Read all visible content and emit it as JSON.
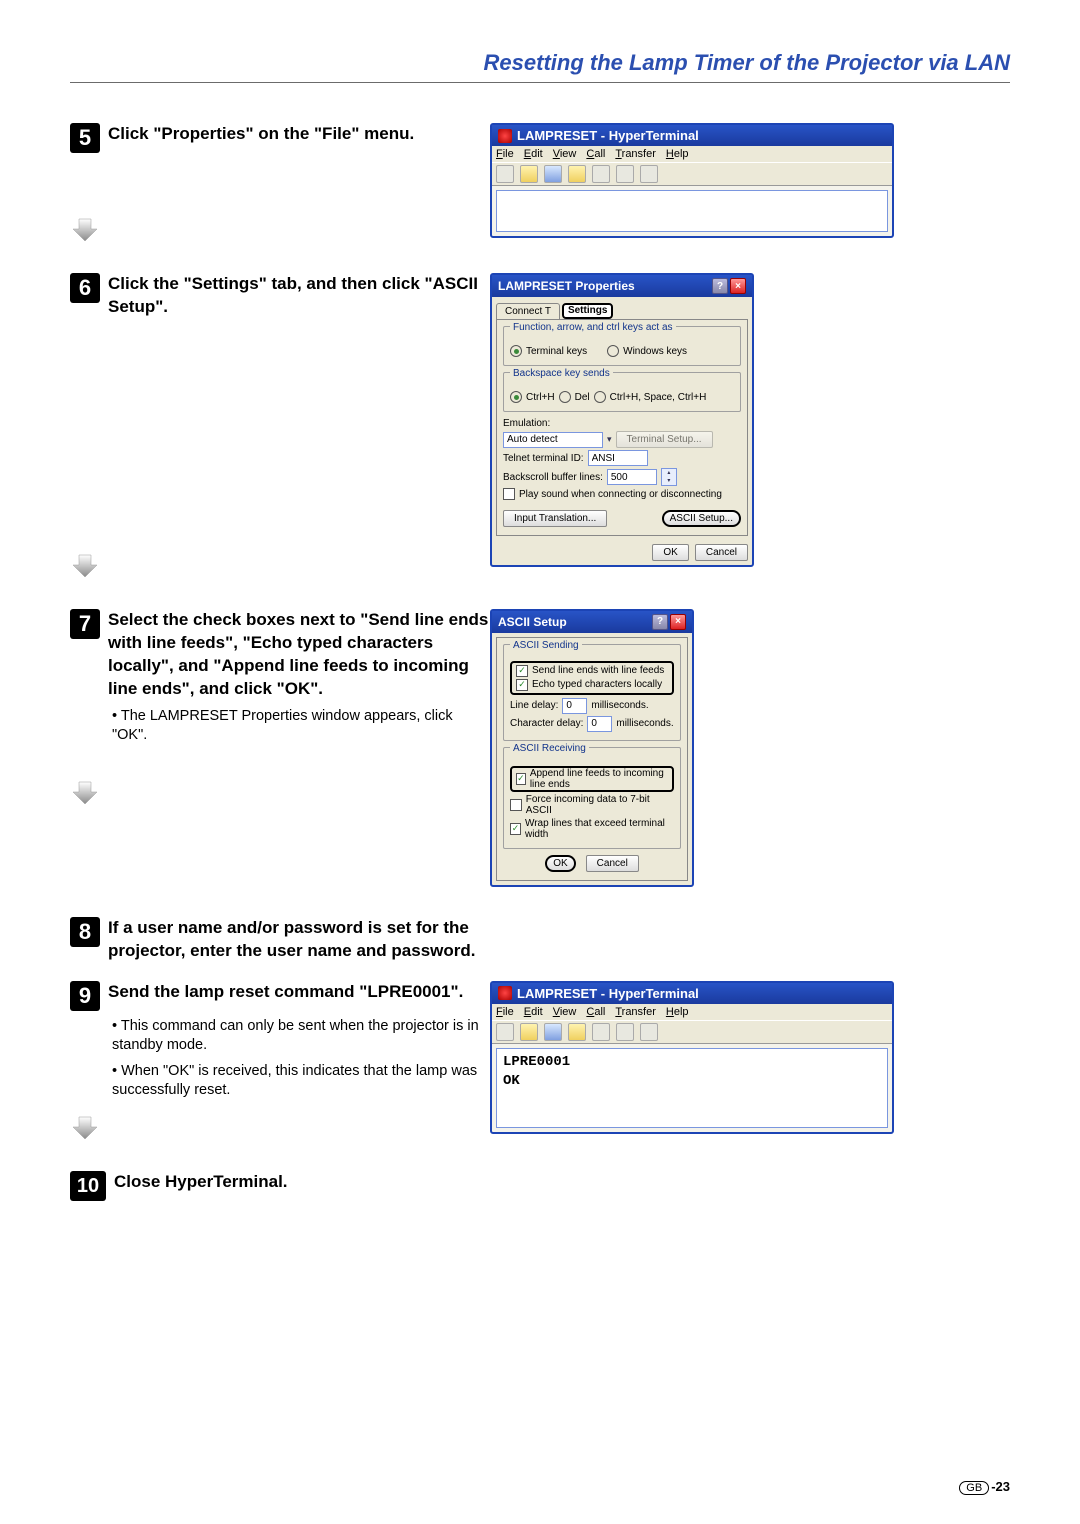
{
  "heading": "Resetting the Lamp Timer of the Projector via LAN",
  "steps": {
    "5": {
      "n": "5",
      "text": "Click \"Properties\" on the \"File\" menu."
    },
    "6": {
      "n": "6",
      "text": "Click the \"Settings\" tab, and then click \"ASCII Setup\"."
    },
    "7": {
      "n": "7",
      "text": "Select the check boxes next to \"Send line ends with line feeds\", \"Echo typed characters locally\", and \"Append line feeds to incoming line ends\", and click \"OK\".",
      "sub": "• The LAMPRESET Properties window appears, click \"OK\"."
    },
    "8": {
      "n": "8",
      "text": "If a user name and/or password is set for the projector, enter the user name and password."
    },
    "9": {
      "n": "9",
      "text": "Send the lamp reset command \"LPRE0001\".",
      "sub1": "• This command can only be sent when the projector is in standby mode.",
      "sub2": "• When \"OK\" is received, this indicates that the lamp was successfully reset."
    },
    "10": {
      "n": "10",
      "text": "Close HyperTerminal."
    }
  },
  "appwin": {
    "title": "LAMPRESET - HyperTerminal",
    "menus": {
      "file": "File",
      "edit": "Edit",
      "view": "View",
      "call": "Call",
      "transfer": "Transfer",
      "help": "Help"
    }
  },
  "propdlg": {
    "title": "LAMPRESET Properties",
    "tab1": "Connect T",
    "tab2": "Settings",
    "grp1": "Function, arrow, and ctrl keys act as",
    "r1": "Terminal keys",
    "r2": "Windows keys",
    "grp2": "Backspace key sends",
    "r3": "Ctrl+H",
    "r4": "Del",
    "r5": "Ctrl+H, Space, Ctrl+H",
    "emu_lbl": "Emulation:",
    "emu_val": "Auto detect",
    "ts_btn": "Terminal Setup...",
    "tid_lbl": "Telnet terminal ID:",
    "tid_val": "ANSI",
    "bb_lbl": "Backscroll buffer lines:",
    "bb_val": "500",
    "ps": "Play sound when connecting or disconnecting",
    "it_btn": "Input Translation...",
    "as_btn": "ASCII Setup...",
    "ok": "OK",
    "cancel": "Cancel"
  },
  "asciidlg": {
    "title": "ASCII Setup",
    "grp1": "ASCII Sending",
    "c1": "Send line ends with line feeds",
    "c2": "Echo typed characters locally",
    "ld_lbl": "Line delay:",
    "ld_val": "0",
    "ld_unit": "milliseconds.",
    "cd_lbl": "Character delay:",
    "cd_val": "0",
    "cd_unit": "milliseconds.",
    "grp2": "ASCII Receiving",
    "c3": "Append line feeds to incoming line ends",
    "c4": "Force incoming data to 7-bit ASCII",
    "c5": "Wrap lines that exceed terminal width",
    "ok": "OK",
    "cancel": "Cancel"
  },
  "termout": {
    "l1": "LPRE0001",
    "l2": "OK"
  },
  "footer": {
    "gb": "GB",
    "page": "-23"
  }
}
